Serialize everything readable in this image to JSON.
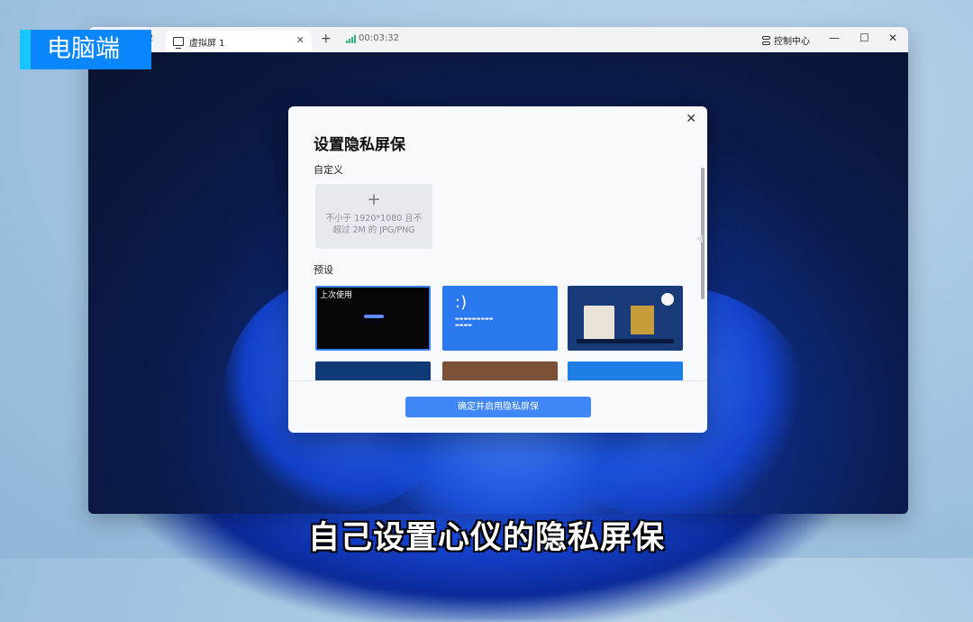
{
  "overlay": {
    "device_tag": "电脑端",
    "subtitle": "自己设置心仪的隐私屏保"
  },
  "window": {
    "prev_tab_num": "2",
    "active_tab_label": "虚拟屏 1",
    "tab_close": "✕",
    "new_tab": "+",
    "timer": "00:03:32",
    "control_center": "控制中心",
    "minimize": "—",
    "maximize": "☐",
    "close": "✕"
  },
  "modal": {
    "close": "✕",
    "title": "设置隐私屏保",
    "custom_label": "自定义",
    "upload_plus": "+",
    "upload_hint": "不小于 1920*1080 且不超过 2M 的 JPG/PNG",
    "preset_label": "预设",
    "last_used_tag": "上次使用",
    "blue_smile": ":)",
    "confirm_button": "确定并启用隐私屏保"
  },
  "colors": {
    "accent": "#3f86f7",
    "tag_blue": "#0a87ff",
    "tag_cyan": "#18c7ff"
  }
}
